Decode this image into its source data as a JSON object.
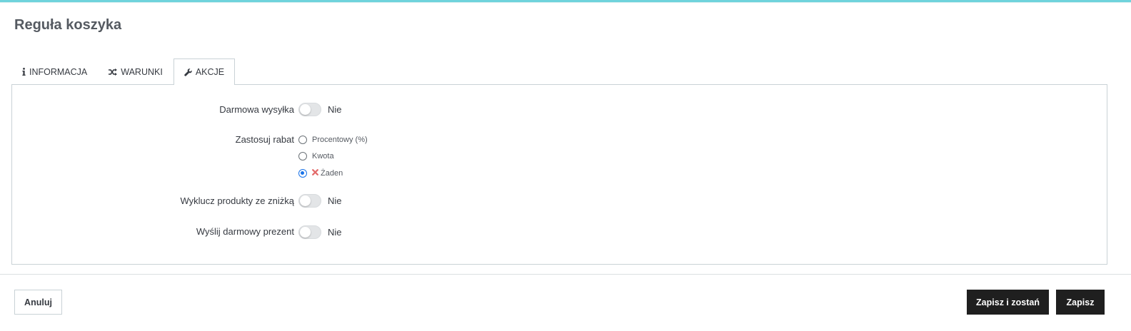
{
  "page": {
    "title": "Reguła koszyka"
  },
  "tabs": [
    {
      "label": "INFORMACJA",
      "icon": "info-icon",
      "active": false
    },
    {
      "label": "WARUNKI",
      "icon": "shuffle-icon",
      "active": false
    },
    {
      "label": "AKCJE",
      "icon": "wrench-icon",
      "active": true
    }
  ],
  "form": {
    "free_shipping": {
      "label": "Darmowa wysyłka",
      "value": "Nie",
      "enabled": false
    },
    "discount": {
      "label": "Zastosuj rabat",
      "options": [
        {
          "label": "Procentowy (%)",
          "checked": false
        },
        {
          "label": "Kwota",
          "checked": false
        },
        {
          "label": "Żaden",
          "checked": true,
          "icon": "x-icon"
        }
      ]
    },
    "exclude_discounted": {
      "label": "Wyklucz produkty ze zniżką",
      "value": "Nie",
      "enabled": false
    },
    "free_gift": {
      "label": "Wyślij darmowy prezent",
      "value": "Nie",
      "enabled": false
    }
  },
  "footer": {
    "cancel_label": "Anuluj",
    "save_stay_label": "Zapisz i zostań",
    "save_label": "Zapisz"
  },
  "colors": {
    "accent": "#6fd3dc",
    "radio_checked": "#1a73e8",
    "x_icon": "#e36b6b",
    "button_dark": "#1f1f1f"
  }
}
